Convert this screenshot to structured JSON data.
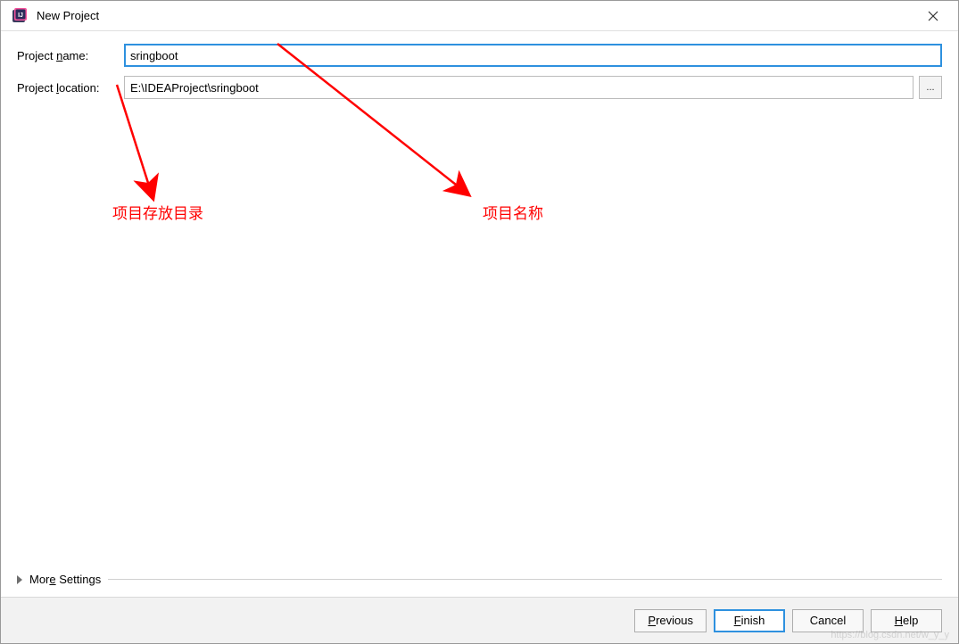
{
  "title_bar": {
    "title": "New Project"
  },
  "form": {
    "project_name_label": "Project name:",
    "project_name_value": "sringboot",
    "project_location_label": "Project location:",
    "project_location_value": "E:\\IDEAProject\\sringboot",
    "browse_label": "..."
  },
  "annotations": {
    "location_note": "项目存放目录",
    "name_note": "项目名称"
  },
  "more_settings": {
    "label": "More Settings"
  },
  "footer": {
    "previous": "Previous",
    "finish": "Finish",
    "cancel": "Cancel",
    "help": "Help"
  },
  "watermark": "https://blog.csdn.net/w_y_y"
}
